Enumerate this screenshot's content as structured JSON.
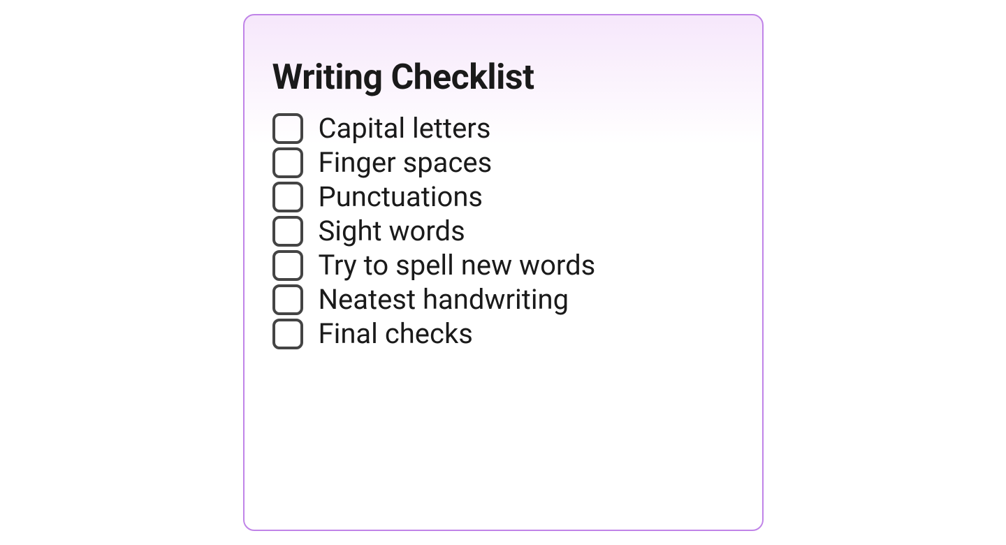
{
  "card": {
    "title": "Writing Checklist",
    "items": [
      {
        "label": "Capital letters"
      },
      {
        "label": "Finger spaces"
      },
      {
        "label": "Punctuations"
      },
      {
        "label": "Sight words"
      },
      {
        "label": "Try to spell new words"
      },
      {
        "label": "Neatest handwriting"
      },
      {
        "label": "Final checks"
      }
    ]
  }
}
